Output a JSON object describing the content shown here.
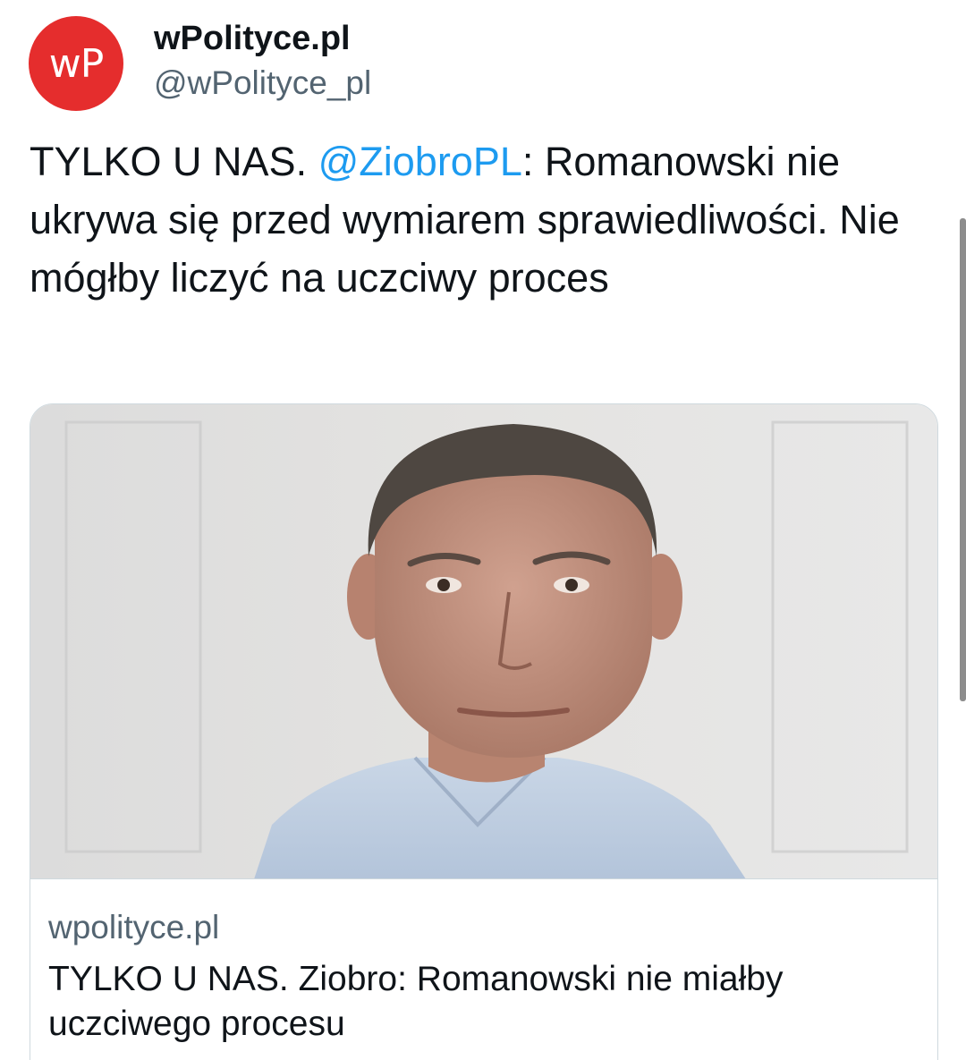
{
  "header": {
    "avatar_text": "wP",
    "display_name": "wPolityce.pl",
    "handle": "@wPolityce_pl"
  },
  "tweet": {
    "text_before": "TYLKO U NAS. ",
    "mention": "@ZiobroPL",
    "text_after": ": Romanowski nie ukrywa się przed wymiarem sprawiedliwości. Nie mógłby liczyć na uczciwy proces"
  },
  "card": {
    "domain": "wpolityce.pl",
    "title": "TYLKO U NAS. Ziobro: Romanowski nie miałby uczciwego procesu"
  },
  "colors": {
    "avatar_bg": "#e52d2d",
    "mention": "#1d9bf0",
    "secondary_text": "#536471",
    "border": "#cfd9de"
  }
}
